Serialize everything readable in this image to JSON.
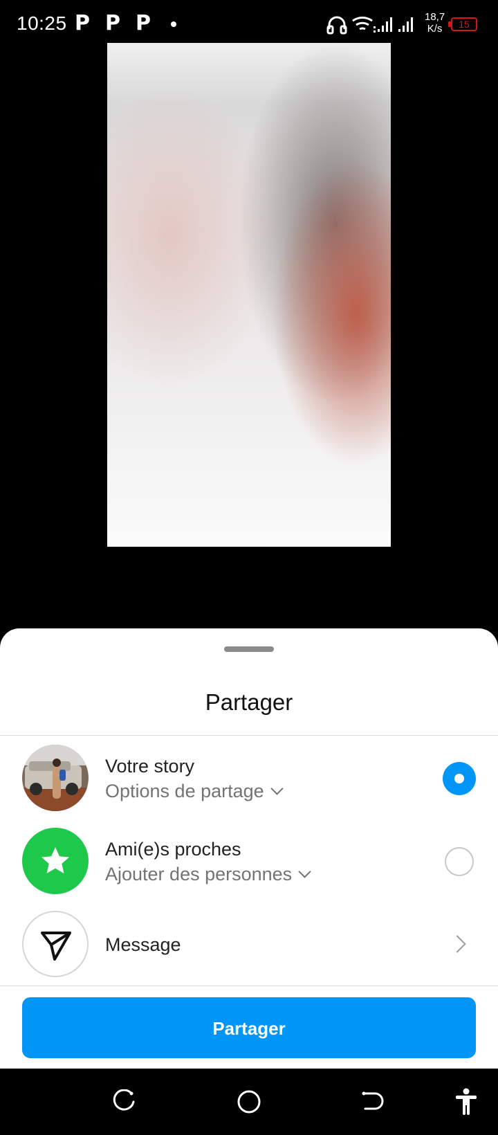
{
  "status_bar": {
    "time": "10:25",
    "notification_letters": [
      "P",
      "P",
      "P"
    ],
    "speed_value": "18,7",
    "speed_unit": "K/s",
    "battery_level": "15",
    "battery_color": "#d01818"
  },
  "sheet": {
    "title": "Partager",
    "options": [
      {
        "title": "Votre story",
        "subtitle": "Options de partage",
        "selected": true
      },
      {
        "title": "Ami(e)s proches",
        "subtitle": "Ajouter des personnes",
        "selected": false
      },
      {
        "title": "Message"
      }
    ],
    "share_button_label": "Partager",
    "accent_color": "#0095f6",
    "close_friends_color": "#1ec84a"
  },
  "icons": {
    "status": [
      "headphones-icon",
      "wifi-icon",
      "signal-icon",
      "battery-icon"
    ],
    "rows": [
      "avatar",
      "star-icon",
      "paper-plane-icon",
      "chevron-right-icon"
    ],
    "navigation": [
      "recent-apps-icon",
      "home-icon",
      "back-icon",
      "accessibility-icon"
    ]
  }
}
